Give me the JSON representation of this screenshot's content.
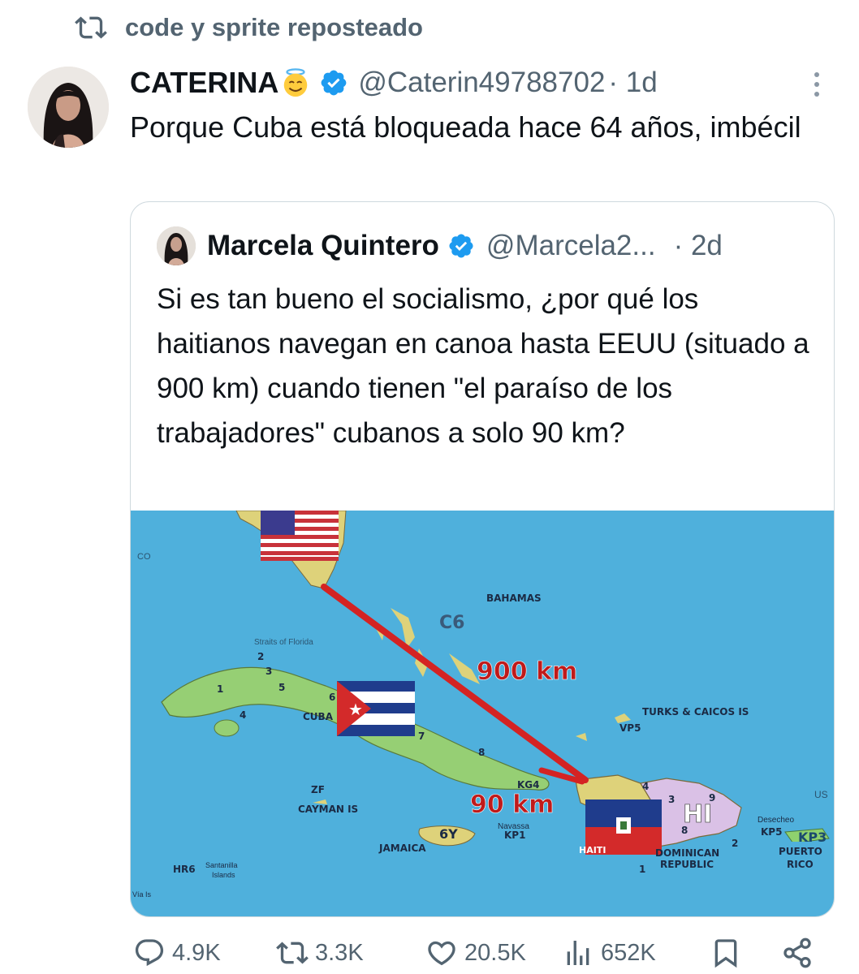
{
  "repost": {
    "label": "code y sprite reposteado"
  },
  "tweet": {
    "author_name": "CATERINA",
    "author_handle": "@Caterin49788702",
    "time": "· 1d",
    "text": "Porque Cuba está bloqueada hace 64 años, imbécil"
  },
  "quote": {
    "author_name": "Marcela Quintero",
    "author_handle": "@Marcela2...",
    "time": "· 2d",
    "text": "Si es tan bueno el socialismo, ¿por qué los haitianos navegan en canoa hasta EEUU (situado a 900 km) cuando tienen \"el paraíso de los trabajadores\" cubanos a solo 90 km?"
  },
  "map": {
    "labels": {
      "bahamas": "BAHAMAS",
      "c6": "C6",
      "straits": "Straits of Florida",
      "cuba": "CUBA",
      "turks": "TURKS & CAICOS IS",
      "vp5": "VP5",
      "kg4": "KG4",
      "zf": "ZF",
      "cayman": "CAYMAN IS",
      "navassa": "Navassa",
      "kp1": "KP1",
      "jamaica": "JAMAICA",
      "sixy": "6Y",
      "haiti": "HAITI",
      "hi": "HI",
      "dominican1": "DOMINICAN",
      "dominican2": "REPUBLIC",
      "desecheo": "Desecheo",
      "kp5": "KP5",
      "kp3": "KP3",
      "puerto1": "PUERTO",
      "rico": "RICO",
      "us": "US",
      "hr6": "HR6",
      "santanilla": "Santanilla",
      "islands": "Islands",
      "co": "CO",
      "vias": "Vía Is",
      "km900": "900 km",
      "km90": "90 km",
      "num1": "1",
      "num2": "2",
      "num3": "3",
      "num4": "4",
      "num5": "5",
      "num6": "6",
      "num7": "7",
      "num8": "8",
      "num9": "9"
    }
  },
  "actions": {
    "replies": "4.9K",
    "reposts": "3.3K",
    "likes": "20.5K",
    "views": "652K"
  },
  "colors": {
    "verified": "#1d9bf0",
    "secondary_text": "#536471",
    "sea": "#4fb0dc",
    "route": "#d42323"
  }
}
